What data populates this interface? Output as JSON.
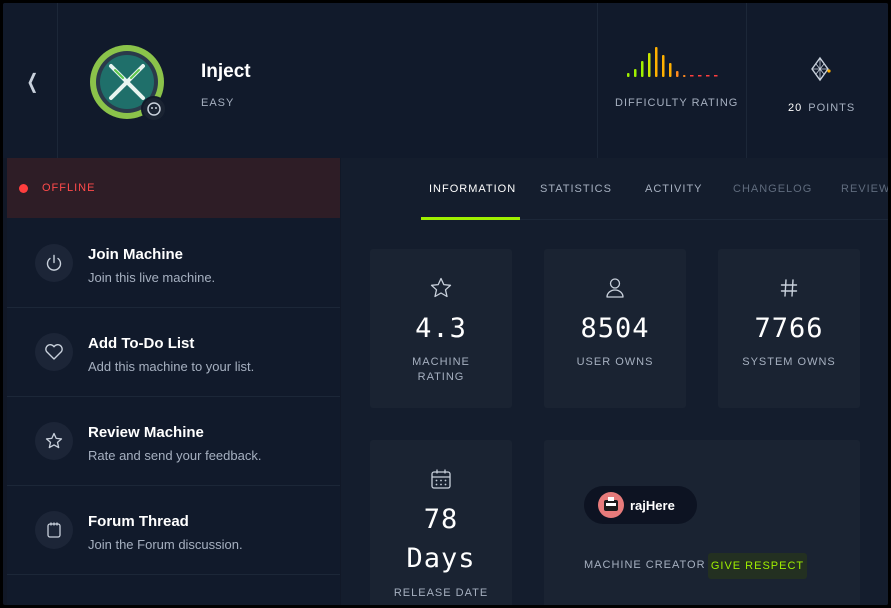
{
  "machine": {
    "name": "Inject",
    "difficulty": "EASY",
    "difficulty_label": "DIFFICULTY RATING",
    "points_value": "20",
    "points_label": "POINTS"
  },
  "status": {
    "text": "OFFLINE",
    "color": "#ff4a4a"
  },
  "actions": [
    {
      "title": "Join Machine",
      "subtitle": "Join this live machine.",
      "icon": "power-icon"
    },
    {
      "title": "Add To-Do List",
      "subtitle": "Add this machine to your list.",
      "icon": "heart-icon"
    },
    {
      "title": "Review Machine",
      "subtitle": "Rate and send your feedback.",
      "icon": "star-icon"
    },
    {
      "title": "Forum Thread",
      "subtitle": "Join the Forum discussion.",
      "icon": "forum-icon"
    }
  ],
  "tabs": [
    {
      "label": "INFORMATION",
      "active": true
    },
    {
      "label": "STATISTICS",
      "active": false
    },
    {
      "label": "ACTIVITY",
      "active": false
    },
    {
      "label": "CHANGELOG",
      "active": false
    },
    {
      "label": "REVIEWS",
      "active": false
    }
  ],
  "stats": {
    "rating": {
      "value": "4.3",
      "label": "MACHINE RATING"
    },
    "user_owns": {
      "value": "8504",
      "label": "USER OWNS"
    },
    "system_owns": {
      "value": "7766",
      "label": "SYSTEM OWNS"
    },
    "release": {
      "value": "78",
      "unit": "Days",
      "label": "RELEASE DATE"
    }
  },
  "creator": {
    "name": "rajHere",
    "label": "MACHINE CREATOR",
    "respect_label": "GIVE RESPECT"
  },
  "colors": {
    "accent": "#9fef00",
    "background": "#111827",
    "card": "#1a2332",
    "offline": "#ff3e3e"
  }
}
